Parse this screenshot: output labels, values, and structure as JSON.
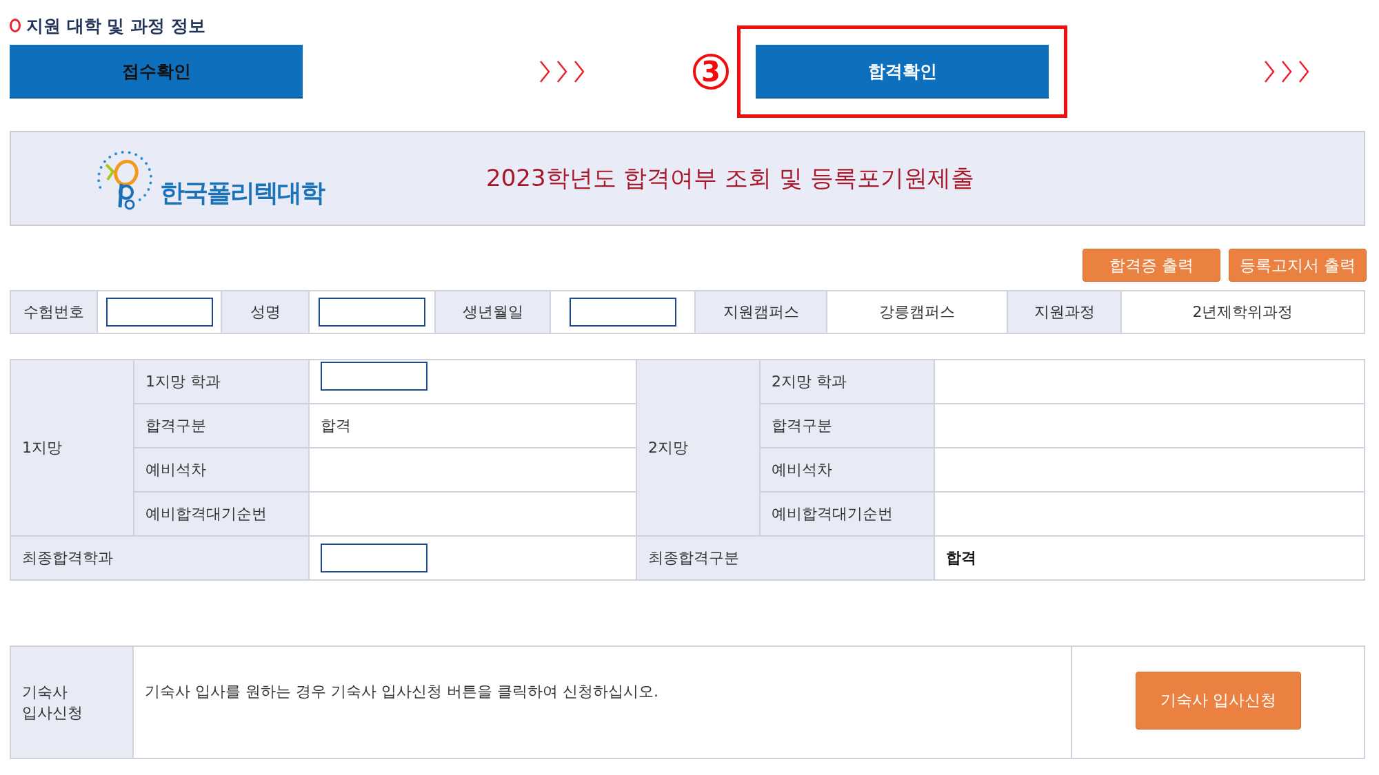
{
  "section_title": "지원 대학 및 과정 정보",
  "steps": [
    {
      "label": "접수확인",
      "active": false,
      "highlighted": false
    },
    {
      "label": "합격확인",
      "active": true,
      "highlighted": true,
      "marker": "3"
    }
  ],
  "banner": {
    "brand": "한국폴리텍대학",
    "title": "2023학년도 합격여부 조회 및 등록포기원제출"
  },
  "actions": [
    "합격증 출력",
    "등록고지서 출력"
  ],
  "applicant": [
    {
      "label": "수험번호",
      "kind": "field"
    },
    {
      "label": "성명",
      "kind": "field"
    },
    {
      "label": "생년월일",
      "kind": "field"
    },
    {
      "label": "지원캠퍼스",
      "kind": "text",
      "value": "강릉캠퍼스"
    },
    {
      "label": "지원과정",
      "kind": "text",
      "value": "2년제학위과정"
    }
  ],
  "choices": [
    {
      "title": "1지망",
      "rows": [
        {
          "label": "1지망 학과",
          "kind": "field"
        },
        {
          "label": "합격구분",
          "kind": "text",
          "value": "합격"
        },
        {
          "label": "예비석차",
          "kind": "text"
        },
        {
          "label": "예비합격대기순번",
          "kind": "text"
        }
      ]
    },
    {
      "title": "2지망",
      "rows": [
        {
          "label": "2지망 학과",
          "kind": "text"
        },
        {
          "label": "합격구분",
          "kind": "text"
        },
        {
          "label": "예비석차",
          "kind": "text"
        },
        {
          "label": "예비합격대기순번",
          "kind": "text"
        }
      ]
    }
  ],
  "final": [
    {
      "label": "최종합격학과",
      "kind": "field"
    },
    {
      "label": "최종합격구분",
      "kind": "text",
      "value": "합격",
      "emphasis": true
    }
  ],
  "dormitory": {
    "label": "기숙사\n입사신청",
    "message": "기숙사 입사를 원하는 경우 기숙사 입사신청 버튼을 클릭하여 신청하십시오.",
    "button": "기숙사 입사신청"
  }
}
